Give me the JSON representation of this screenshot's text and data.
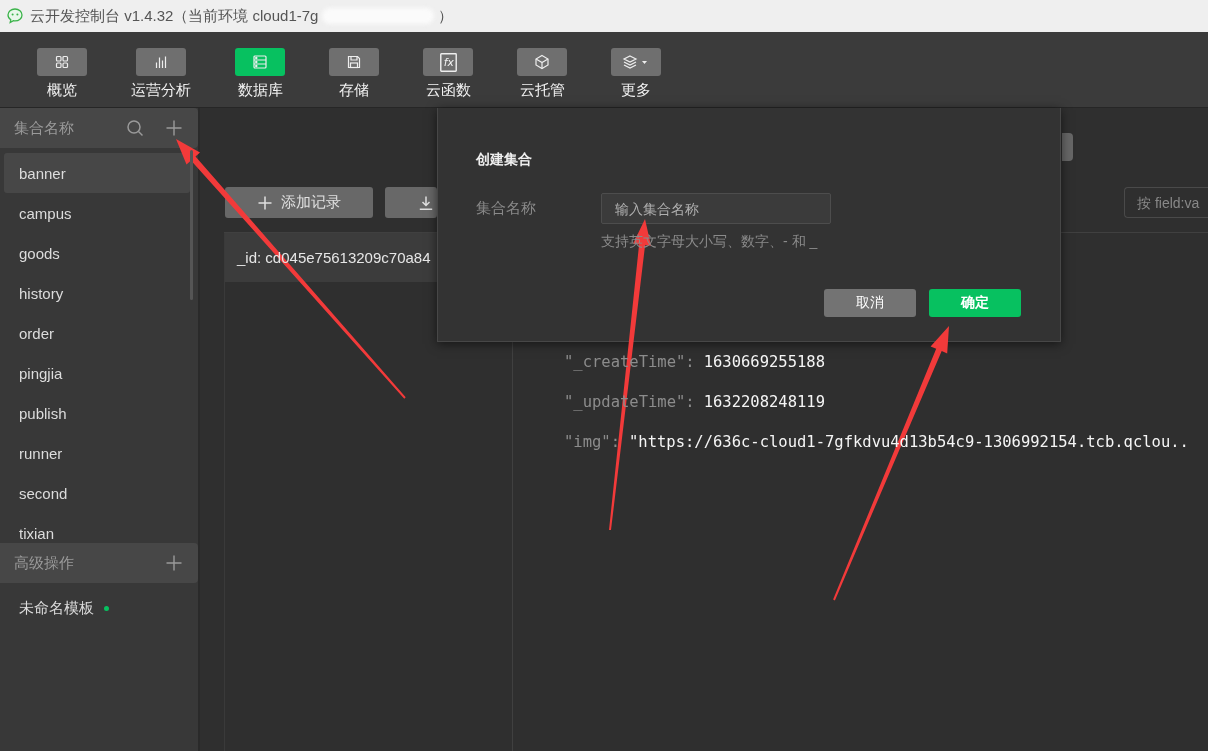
{
  "window": {
    "title": "云开发控制台 v1.4.32（当前环境 cloud1-7g",
    "title_end": "）"
  },
  "toolbar": {
    "items": [
      {
        "label": "概览",
        "kind": "grid",
        "selected": false
      },
      {
        "label": "运营分析",
        "kind": "bars",
        "selected": false
      },
      {
        "label": "数据库",
        "kind": "database",
        "selected": true
      },
      {
        "label": "存储",
        "kind": "storage",
        "selected": false
      },
      {
        "label": "云函数",
        "kind": "function",
        "icon_text": "fx",
        "selected": false
      },
      {
        "label": "云托管",
        "kind": "cube",
        "selected": false
      },
      {
        "label": "更多",
        "kind": "more",
        "selected": false
      }
    ]
  },
  "sidebar": {
    "collections_header": "集合名称",
    "collections": [
      {
        "name": "banner",
        "selected": true
      },
      {
        "name": "campus",
        "selected": false
      },
      {
        "name": "goods",
        "selected": false
      },
      {
        "name": "history",
        "selected": false
      },
      {
        "name": "order",
        "selected": false
      },
      {
        "name": "pingjia",
        "selected": false
      },
      {
        "name": "publish",
        "selected": false
      },
      {
        "name": "runner",
        "selected": false
      },
      {
        "name": "second",
        "selected": false
      },
      {
        "name": "tixian",
        "selected": false
      }
    ],
    "advanced_header": "高级操作",
    "templates": [
      {
        "name": "未命名模板",
        "color": "#07c160"
      }
    ]
  },
  "main": {
    "add_button": "添加记录",
    "search": {
      "placeholder": "按 field:va"
    },
    "records": [
      {
        "id": "_id: cd045e75613209c70a84",
        "selected": true
      }
    ],
    "document": [
      {
        "key": "\"_createTime\":",
        "value": "1630669255188"
      },
      {
        "key": "\"_updateTime\":",
        "value": "1632208248119"
      },
      {
        "key": "\"img\":",
        "value": "\"https://636c-cloud1-7gfkdvu4d13b54c9-1306992154.tcb.qclou.."
      }
    ]
  },
  "dialog": {
    "title": "创建集合",
    "field_label": "集合名称",
    "input": {
      "placeholder": "输入集合名称"
    },
    "hint": "支持英文字母大小写、数字、- 和 _",
    "buttons": [
      {
        "label": "取消",
        "kind": "secondary"
      },
      {
        "label": "确定",
        "kind": "primary"
      }
    ]
  }
}
